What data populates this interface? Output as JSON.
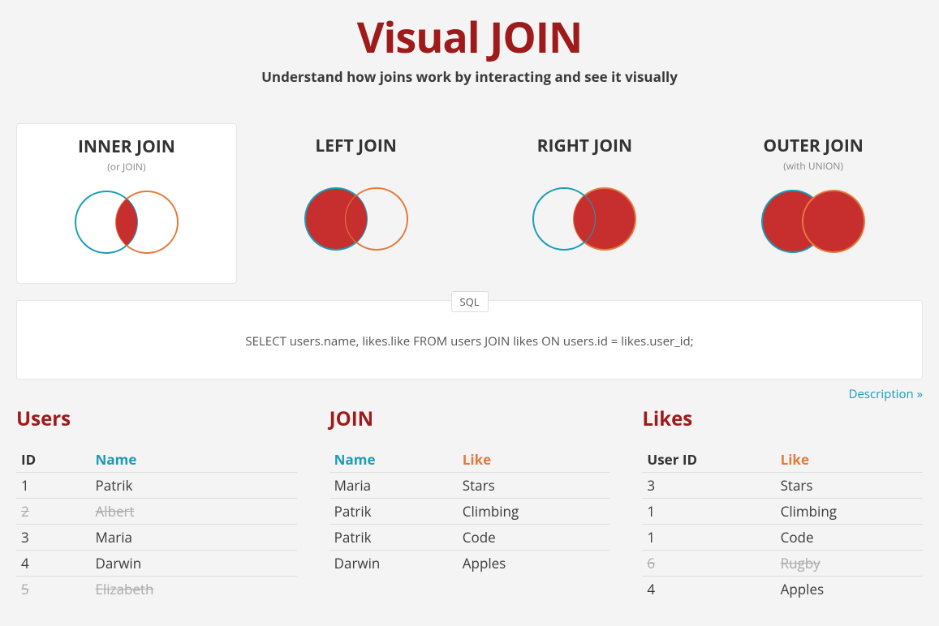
{
  "header": {
    "title": "Visual JOIN",
    "subtitle": "Understand how joins work by interacting and see it visually"
  },
  "tabs": [
    {
      "label": "INNER JOIN",
      "sub": "(or JOIN)",
      "active": true,
      "type": "inner"
    },
    {
      "label": "LEFT JOIN",
      "sub": "",
      "active": false,
      "type": "left"
    },
    {
      "label": "RIGHT JOIN",
      "sub": "",
      "active": false,
      "type": "right"
    },
    {
      "label": "OUTER JOIN",
      "sub": "(with UNION)",
      "active": false,
      "type": "outer"
    }
  ],
  "sql": {
    "label": "SQL",
    "query": "SELECT users.name, likes.like FROM users JOIN likes ON users.id = likes.user_id;"
  },
  "description_link": "Description »",
  "users": {
    "title": "Users",
    "headers": {
      "id": "ID",
      "name": "Name"
    },
    "rows": [
      {
        "id": "1",
        "name": "Patrik",
        "strike": false
      },
      {
        "id": "2",
        "name": "Albert",
        "strike": true
      },
      {
        "id": "3",
        "name": "Maria",
        "strike": false
      },
      {
        "id": "4",
        "name": "Darwin",
        "strike": false
      },
      {
        "id": "5",
        "name": "Elizabeth",
        "strike": true
      }
    ]
  },
  "join": {
    "title": "JOIN",
    "headers": {
      "name": "Name",
      "like": "Like"
    },
    "rows": [
      {
        "name": "Maria",
        "like": "Stars"
      },
      {
        "name": "Patrik",
        "like": "Climbing"
      },
      {
        "name": "Patrik",
        "like": "Code"
      },
      {
        "name": "Darwin",
        "like": "Apples"
      }
    ]
  },
  "likes": {
    "title": "Likes",
    "headers": {
      "user_id": "User ID",
      "like": "Like"
    },
    "rows": [
      {
        "user_id": "3",
        "like": "Stars",
        "strike": false
      },
      {
        "user_id": "1",
        "like": "Climbing",
        "strike": false
      },
      {
        "user_id": "1",
        "like": "Code",
        "strike": false
      },
      {
        "user_id": "6",
        "like": "Rugby",
        "strike": true
      },
      {
        "user_id": "4",
        "like": "Apples",
        "strike": false
      }
    ]
  }
}
